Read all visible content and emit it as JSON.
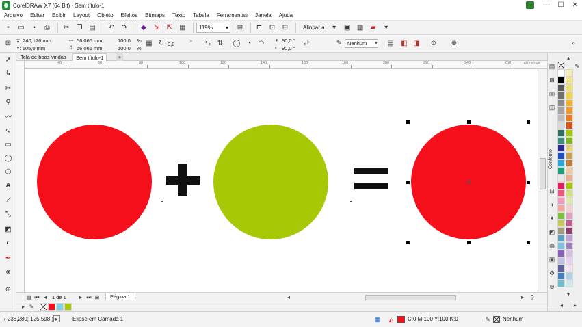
{
  "window": {
    "title": "CorelDRAW X7 (64 Bit) - Sem título-1",
    "controls": [
      "—",
      "☐",
      "✕"
    ]
  },
  "menu": [
    "Arquivo",
    "Editar",
    "Exibir",
    "Layout",
    "Objeto",
    "Efeitos",
    "Bitmaps",
    "Texto",
    "Tabela",
    "Ferramentas",
    "Janela",
    "Ajuda"
  ],
  "toolbar": {
    "zoom": "119%",
    "align_label": "Alinhar a"
  },
  "property_bar": {
    "x": "X: 240,176 mm",
    "y": "Y: 105,0 mm",
    "width": "56,066 mm",
    "height": "56,066 mm",
    "scale_x": "100,0",
    "scale_y": "100,0",
    "pct_x": "%",
    "pct_y": "%",
    "rotation": "0,0",
    "degree": "°",
    "angle_start": "90,0 °",
    "angle_end": "90,0 °",
    "outline": "Nenhum"
  },
  "doc_tabs": [
    "Tela de boas-vindas",
    "Sem título-1"
  ],
  "ruler": {
    "h_ticks": [
      "40",
      "60",
      "80",
      "100",
      "120",
      "140",
      "160",
      "180",
      "200",
      "220",
      "240",
      "260"
    ],
    "unit": "milímetros"
  },
  "canvas": {
    "shapes": [
      {
        "name": "red-circle-left",
        "color": "#f40f1b"
      },
      {
        "name": "plus-sign",
        "text": "+"
      },
      {
        "name": "green-circle",
        "color": "#a7c805"
      },
      {
        "name": "equals-sign",
        "text": "="
      },
      {
        "name": "red-circle-selected",
        "color": "#f40f1b"
      }
    ]
  },
  "docker": {
    "label": "Contorno"
  },
  "page_nav": {
    "page_count": "1 de 1",
    "page_tab": "Página 1"
  },
  "status": {
    "coords": "( 238,280; 125,598 )",
    "object_info": "Elipse em Camada 1",
    "fill_info": "C:0 M:100 Y:100 K:0",
    "outline_info": "Nenhum"
  },
  "colors": {
    "red": "#f40f1b",
    "green": "#a7c805",
    "brand": "#1f8f3a"
  }
}
